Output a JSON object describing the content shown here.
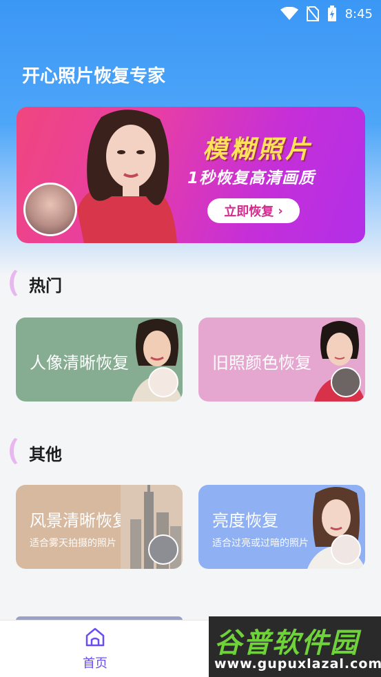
{
  "status": {
    "time": "8:45"
  },
  "app": {
    "title": "开心照片恢复专家"
  },
  "banner": {
    "title": "模糊照片",
    "subtitle": "1秒恢复高清画质",
    "button_label": "立即恢复",
    "button_chevron": "›"
  },
  "sections": [
    {
      "title": "热门"
    },
    {
      "title": "其他"
    }
  ],
  "hot_cards": [
    {
      "title": "人像清晰恢复",
      "color": "#86ad92"
    },
    {
      "title": "旧照颜色恢复",
      "color": "#e5a7cf"
    }
  ],
  "other_cards": [
    {
      "title": "风景清晰恢复",
      "subtitle": "适合雾天拍摄的照片",
      "color": "#d7b9a0"
    },
    {
      "title": "亮度恢复",
      "subtitle": "适合过亮或过暗的照片",
      "color": "#8fb1f3"
    }
  ],
  "tabbar": {
    "home_label": "首页",
    "accent": "#6a4df2"
  },
  "watermark": {
    "big": "谷普软件园",
    "small": "www.gupuxlazal.com"
  }
}
